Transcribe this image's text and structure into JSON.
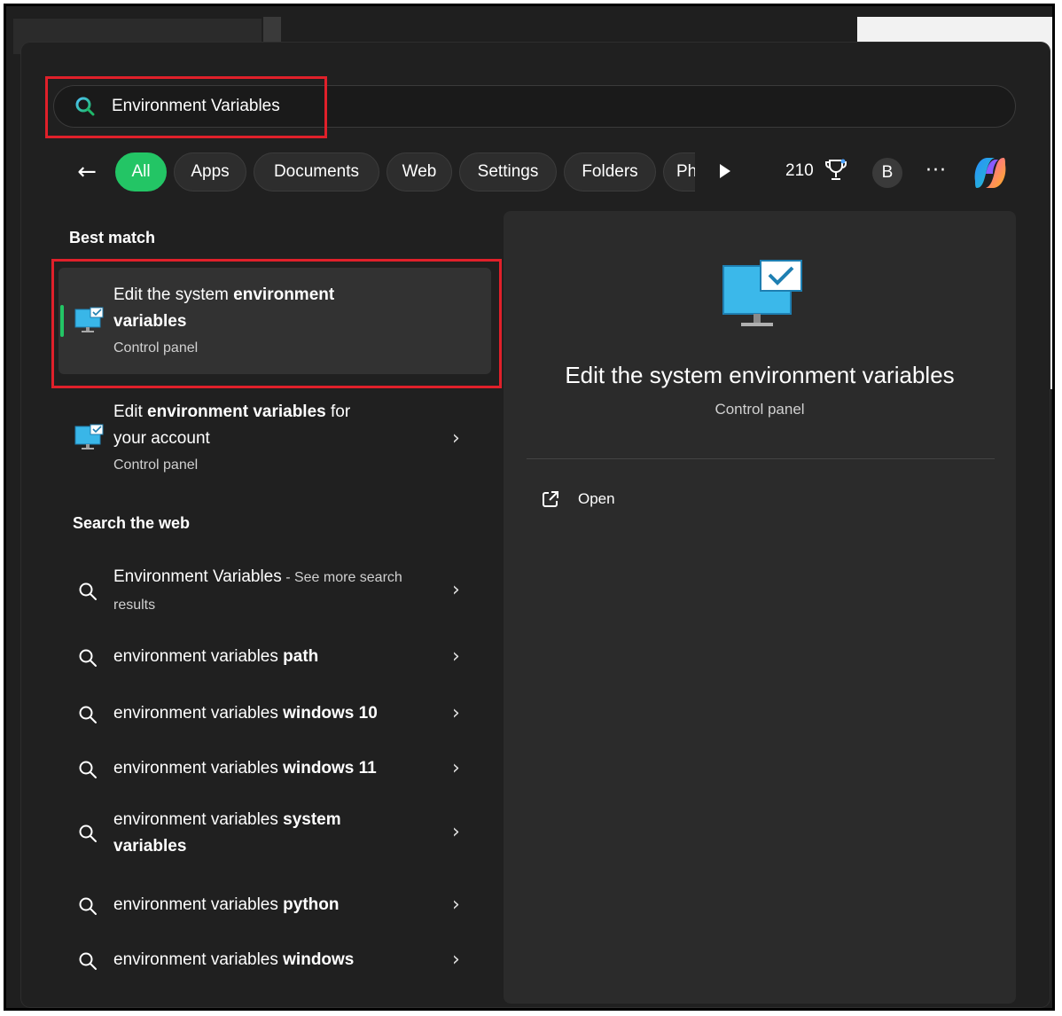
{
  "search": {
    "query": "Environment Variables"
  },
  "filters": {
    "chips": [
      "All",
      "Apps",
      "Documents",
      "Web",
      "Settings",
      "Folders",
      "Ph"
    ],
    "active": "All"
  },
  "toolbar": {
    "points": "210",
    "avatar_initial": "B",
    "more": "···"
  },
  "best_match": {
    "heading": "Best match",
    "title_pre": "Edit the system ",
    "title_bold": "environment variables",
    "subtitle": "Control panel"
  },
  "apps": [
    {
      "title_pre": "Edit ",
      "title_bold": "environment variables",
      "title_post": " for your account",
      "subtitle": "Control panel"
    }
  ],
  "web": {
    "heading": "Search the web",
    "first": {
      "query": "Environment Variables",
      "suffix": " - See more search results"
    },
    "items": [
      {
        "pre": "environment variables ",
        "bold": "path"
      },
      {
        "pre": "environment variables ",
        "bold": "windows 10"
      },
      {
        "pre": "environment variables ",
        "bold": "windows 11"
      },
      {
        "pre": "environment variables ",
        "bold": "system variables"
      },
      {
        "pre": "environment variables ",
        "bold": "python"
      },
      {
        "pre": "environment variables ",
        "bold": "windows"
      }
    ]
  },
  "detail": {
    "title": "Edit the system environment variables",
    "subtitle": "Control panel",
    "action_open": "Open"
  },
  "colors": {
    "accent": "#23c565",
    "highlight": "#e0202a",
    "panel": "#202020",
    "detail_panel": "#2b2b2b"
  },
  "icons": {
    "search": "search-icon",
    "back": "arrow-left-icon",
    "play": "play-icon",
    "trophy": "trophy-icon",
    "copilot": "copilot-icon",
    "monitor": "monitor-checkmark-icon",
    "open": "external-link-icon",
    "chevron": "chevron-right-icon"
  }
}
